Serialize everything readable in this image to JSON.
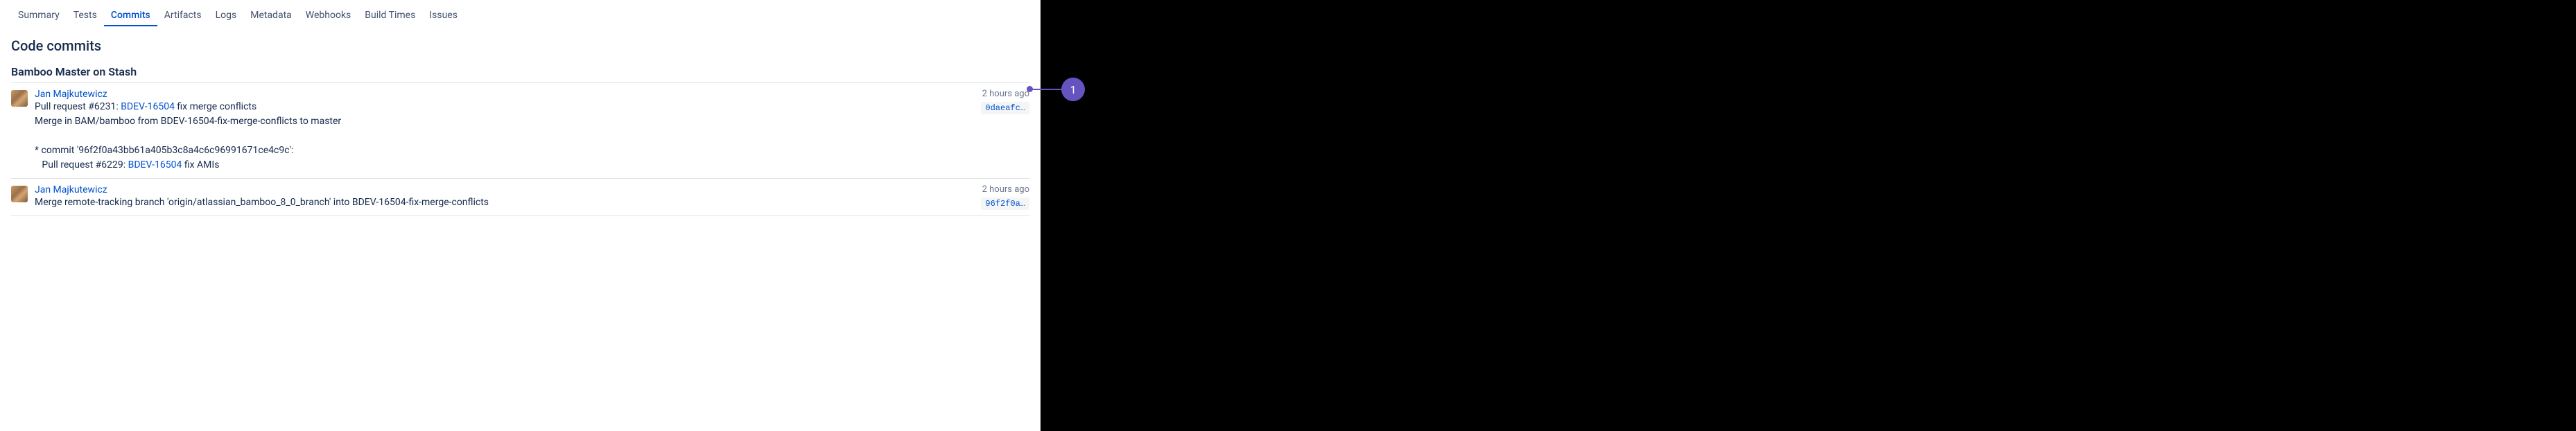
{
  "tabs": [
    {
      "label": "Summary",
      "active": false
    },
    {
      "label": "Tests",
      "active": false
    },
    {
      "label": "Commits",
      "active": true
    },
    {
      "label": "Artifacts",
      "active": false
    },
    {
      "label": "Logs",
      "active": false
    },
    {
      "label": "Metadata",
      "active": false
    },
    {
      "label": "Webhooks",
      "active": false
    },
    {
      "label": "Build Times",
      "active": false
    },
    {
      "label": "Issues",
      "active": false
    }
  ],
  "page_title": "Code commits",
  "section_header": "Bamboo Master on Stash",
  "commits": [
    {
      "author": "Jan Majkutewicz",
      "msg_prefix": "Pull request #6231: ",
      "issue": "BDEV-16504",
      "msg_after_issue": " fix merge conflicts",
      "msg_line2": "Merge in BAM/bamboo from BDEV-16504-fix-merge-conflicts to master",
      "msg_line3": "* commit '96f2f0a43bb61a405b3c8a4c6c96991671ce4c9c':",
      "msg_line4_prefix": "   Pull request #6229: ",
      "msg_line4_issue": "BDEV-16504",
      "msg_line4_after": " fix AMIs",
      "timestamp": "2 hours ago",
      "hash": "0daeafc…"
    },
    {
      "author": "Jan Majkutewicz",
      "msg_line1": "Merge remote-tracking branch 'origin/atlassian_bamboo_8_0_branch' into BDEV-16504-fix-merge-conflicts",
      "timestamp": "2 hours ago",
      "hash": "96f2f0a…"
    }
  ],
  "annotation": {
    "number": "1"
  }
}
